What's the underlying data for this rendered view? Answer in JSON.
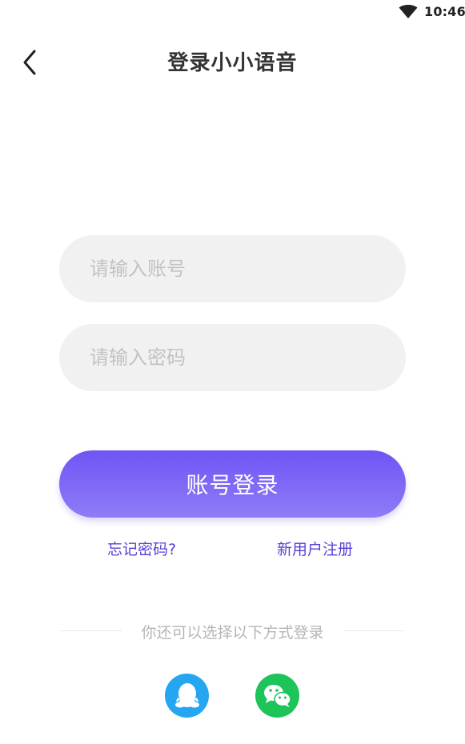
{
  "status_bar": {
    "time": "10:46",
    "wifi_icon": "wifi-icon"
  },
  "header": {
    "back_icon": "chevron-left-icon",
    "title": "登录小小语音"
  },
  "form": {
    "account_placeholder": "请输入账号",
    "account_value": "",
    "password_placeholder": "请输入密码",
    "password_value": "",
    "login_label": "账号登录",
    "forgot_label": "忘记密码?",
    "register_label": "新用户注册"
  },
  "alt_login": {
    "divider_text": "你还可以选择以下方式登录",
    "providers": [
      {
        "name": "QQ",
        "icon": "qq-icon",
        "color": "#24a6f0"
      },
      {
        "name": "WeChat",
        "icon": "wechat-icon",
        "color": "#1dc45a"
      }
    ]
  },
  "colors": {
    "accent": "#6f55f5",
    "link": "#5a3fd6",
    "field_bg": "#f1f1f1"
  }
}
